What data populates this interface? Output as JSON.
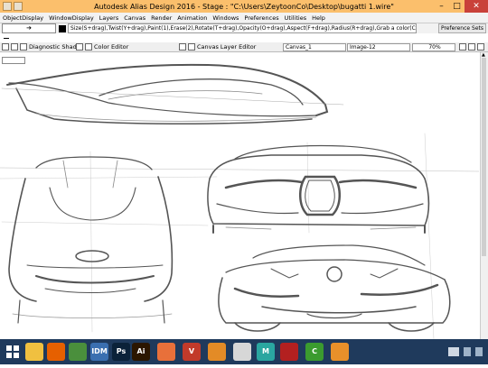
{
  "window": {
    "title": "Autodesk Alias Design 2016    -  Stage : \"C:\\Users\\ZeytoonCo\\Desktop\\bugatti 1.wire\"",
    "controls": {
      "minimize": "–",
      "maximize": "□",
      "close": "✕"
    }
  },
  "menu": [
    "ObjectDisplay",
    "WindowDisplay",
    "Layers",
    "Canvas",
    "Render",
    "Animation",
    "Windows",
    "Preferences",
    "Utilities",
    "Help"
  ],
  "toolbar": {
    "arrow": "➔",
    "hint": "Size(S+drag),Twist(Y+drag),Paint(1),Erase(2),Rotate(T+drag),Opacity(O+drag),Aspect(F+drag),Radius(R+drag),Grab a color(C+drag)",
    "preference_sets": "Preference Sets"
  },
  "panels": {
    "diagnostic_shade": "Diagnostic Shade",
    "color_editor": "Color Editor",
    "canvas_layer_editor": "Canvas Layer Editor",
    "canvas_field": "Canvas_1",
    "image_field": "Image-12",
    "zoom": "70%"
  },
  "taskbar": {
    "apps": [
      {
        "name": "windows-explorer",
        "label": "",
        "color": "#f0c040"
      },
      {
        "name": "firefox",
        "label": "",
        "color": "#e66000"
      },
      {
        "name": "chrome",
        "label": "",
        "color": "#4a8f3c"
      },
      {
        "name": "idm",
        "label": "IDM",
        "color": "#3a6fb0"
      },
      {
        "name": "photoshop",
        "label": "Ps",
        "color": "#0b2239"
      },
      {
        "name": "illustrator",
        "label": "Ai",
        "color": "#2b1600"
      },
      {
        "name": "alias-1",
        "label": "",
        "color": "#e8703a"
      },
      {
        "name": "vectorworks",
        "label": "V",
        "color": "#c23a2a"
      },
      {
        "name": "app-orange",
        "label": "",
        "color": "#e38b26"
      },
      {
        "name": "sketchbook",
        "label": "",
        "color": "#d7d7d7"
      },
      {
        "name": "maya",
        "label": "M",
        "color": "#2aa6a0"
      },
      {
        "name": "app-red",
        "label": "",
        "color": "#b32020"
      },
      {
        "name": "camtasia",
        "label": "C",
        "color": "#3b9b2f"
      },
      {
        "name": "media-player",
        "label": "",
        "color": "#e8902a"
      }
    ]
  }
}
